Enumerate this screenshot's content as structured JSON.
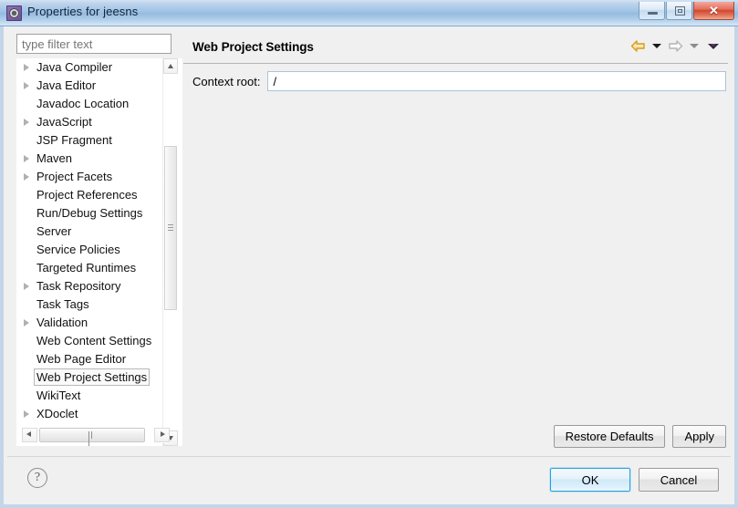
{
  "window": {
    "title": "Properties for jeesns",
    "icon": "eclipse-properties-icon",
    "controls": {
      "minimize": "minimize-icon",
      "maximize": "maximize-icon",
      "close": "✕"
    }
  },
  "sidebar": {
    "filter": {
      "placeholder": "type filter text",
      "value": ""
    },
    "items": [
      {
        "label": "Java Compiler",
        "expandable": true,
        "selected": false
      },
      {
        "label": "Java Editor",
        "expandable": true,
        "selected": false
      },
      {
        "label": "Javadoc Location",
        "expandable": false,
        "selected": false
      },
      {
        "label": "JavaScript",
        "expandable": true,
        "selected": false
      },
      {
        "label": "JSP Fragment",
        "expandable": false,
        "selected": false
      },
      {
        "label": "Maven",
        "expandable": true,
        "selected": false
      },
      {
        "label": "Project Facets",
        "expandable": true,
        "selected": false
      },
      {
        "label": "Project References",
        "expandable": false,
        "selected": false
      },
      {
        "label": "Run/Debug Settings",
        "expandable": false,
        "selected": false
      },
      {
        "label": "Server",
        "expandable": false,
        "selected": false
      },
      {
        "label": "Service Policies",
        "expandable": false,
        "selected": false
      },
      {
        "label": "Targeted Runtimes",
        "expandable": false,
        "selected": false
      },
      {
        "label": "Task Repository",
        "expandable": true,
        "selected": false
      },
      {
        "label": "Task Tags",
        "expandable": false,
        "selected": false
      },
      {
        "label": "Validation",
        "expandable": true,
        "selected": false
      },
      {
        "label": "Web Content Settings",
        "expandable": false,
        "selected": false
      },
      {
        "label": "Web Page Editor",
        "expandable": false,
        "selected": false
      },
      {
        "label": "Web Project Settings",
        "expandable": false,
        "selected": true
      },
      {
        "label": "WikiText",
        "expandable": false,
        "selected": false
      },
      {
        "label": "XDoclet",
        "expandable": true,
        "selected": false
      }
    ]
  },
  "page": {
    "title": "Web Project Settings",
    "nav": {
      "back_icon": "back-arrow-icon",
      "back_dropdown_icon": "chevron-down-icon",
      "forward_icon": "forward-arrow-icon",
      "forward_dropdown_icon": "chevron-down-icon",
      "menu_icon": "view-menu-icon"
    },
    "fields": [
      {
        "label": "Context root:",
        "value": "/",
        "placeholder": ""
      }
    ],
    "buttons": {
      "restore_defaults": "Restore Defaults",
      "apply": "Apply"
    }
  },
  "footer": {
    "help_icon": "?",
    "ok": "OK",
    "cancel": "Cancel"
  },
  "colors": {
    "titlebar_blue": "#9dc1e4",
    "close_red": "#cf4830",
    "default_button_border": "#2e9fd8",
    "back_arrow_gold": "#e0a526",
    "dialog_bg": "#f0f0f0"
  }
}
